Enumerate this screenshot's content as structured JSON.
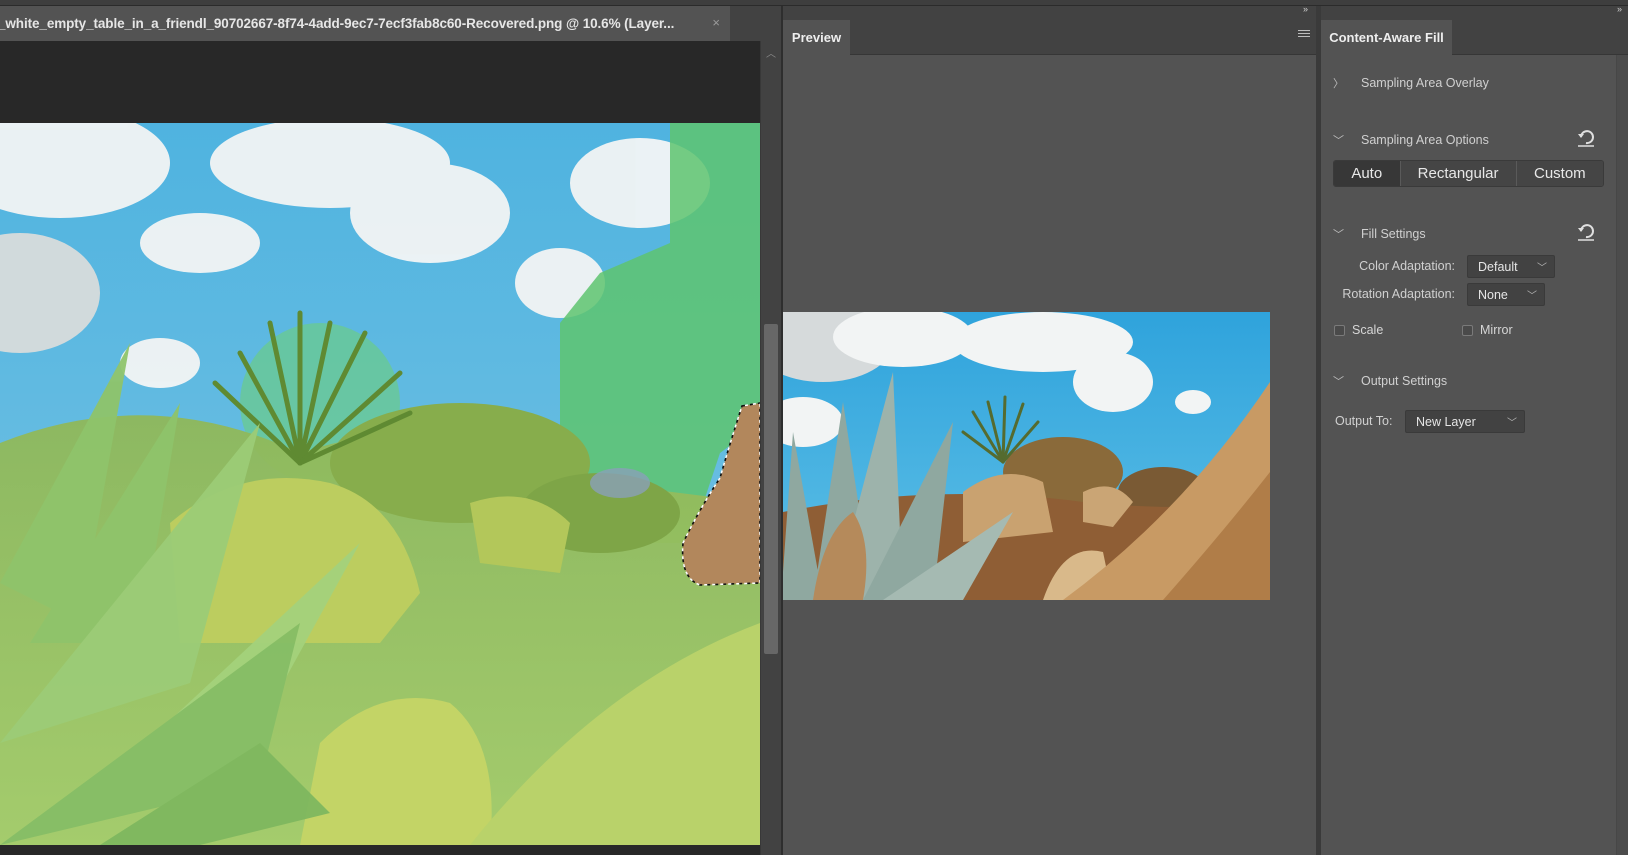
{
  "document": {
    "tab_title": "_white_empty_table_in_a_friendl_90702667-8f74-4add-9ec7-7ecf3fab8c60-Recovered.png @ 10.6% (Layer...",
    "close_icon": "×",
    "zoom_level": "10.6%"
  },
  "preview_panel": {
    "tab_label": "Preview",
    "collapse_icon": "»",
    "menu_icon": "hamburger-menu"
  },
  "content_aware_fill": {
    "tab_label": "Content-Aware Fill",
    "collapse_icon": "»",
    "sections": {
      "sampling_overlay": {
        "label": "Sampling Area Overlay",
        "expanded": false,
        "chevron": "〉"
      },
      "sampling_options": {
        "label": "Sampling Area Options",
        "expanded": true,
        "chevron": "﹀",
        "modes": [
          "Auto",
          "Rectangular",
          "Custom"
        ],
        "selected_mode": "Auto"
      },
      "fill_settings": {
        "label": "Fill Settings",
        "expanded": true,
        "chevron": "﹀",
        "color_adaptation_label": "Color Adaptation:",
        "color_adaptation_value": "Default",
        "rotation_adaptation_label": "Rotation Adaptation:",
        "rotation_adaptation_value": "None",
        "scale_label": "Scale",
        "scale_checked": false,
        "mirror_label": "Mirror",
        "mirror_checked": false
      },
      "output_settings": {
        "label": "Output Settings",
        "expanded": true,
        "chevron": "﹀",
        "output_to_label": "Output To:",
        "output_to_value": "New Layer"
      }
    }
  },
  "dropdown_chevron": "﹀",
  "colors": {
    "panel_bg": "#535353",
    "tabbar_bg": "#424242",
    "canvas_bg": "#282828",
    "overlay_green": "#5ec46e"
  }
}
